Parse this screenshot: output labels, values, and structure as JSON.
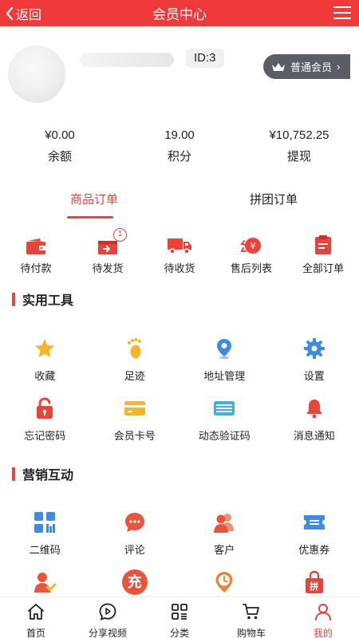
{
  "header": {
    "back_label": "返回",
    "title": "会员中心"
  },
  "profile": {
    "id_label": "ID:3",
    "level_label": "普通会员"
  },
  "stats": [
    {
      "value": "¥0.00",
      "label": "余额"
    },
    {
      "value": "19.00",
      "label": "积分"
    },
    {
      "value": "¥10,752.25",
      "label": "提现"
    }
  ],
  "tabs": [
    {
      "label": "商品订单"
    },
    {
      "label": "拼团订单"
    }
  ],
  "orders": [
    {
      "label": "待付款",
      "icon": "wallet-icon"
    },
    {
      "label": "待发货",
      "icon": "box-upload-icon",
      "badge": "1"
    },
    {
      "label": "待收货",
      "icon": "truck-icon"
    },
    {
      "label": "售后列表",
      "icon": "refund-icon"
    },
    {
      "label": "全部订单",
      "icon": "clipboard-icon"
    }
  ],
  "tools": {
    "title": "实用工具",
    "items": [
      {
        "label": "收藏",
        "icon": "star-icon"
      },
      {
        "label": "足迹",
        "icon": "footprint-icon"
      },
      {
        "label": "地址管理",
        "icon": "location-pin-icon"
      },
      {
        "label": "设置",
        "icon": "gear-icon"
      },
      {
        "label": "忘记密码",
        "icon": "lock-icon"
      },
      {
        "label": "会员卡号",
        "icon": "card-icon"
      },
      {
        "label": "动态验证码",
        "icon": "code-card-icon"
      },
      {
        "label": "消息通知",
        "icon": "bell-icon"
      }
    ]
  },
  "marketing": {
    "title": "营销互动",
    "items": [
      {
        "label": "二维码",
        "icon": "qr-grid-icon"
      },
      {
        "label": "评论",
        "icon": "comment-icon"
      },
      {
        "label": "客户",
        "icon": "customers-icon"
      },
      {
        "label": "优惠券",
        "icon": "coupon-icon"
      },
      {
        "label": "",
        "icon": "user-check-icon"
      },
      {
        "label": "充",
        "icon": "recharge-icon"
      },
      {
        "label": "",
        "icon": "clock-pin-icon"
      },
      {
        "label": "拼",
        "icon": "group-bag-icon"
      }
    ]
  },
  "tabbar": [
    {
      "label": "首页",
      "icon": "home-icon"
    },
    {
      "label": "分享视频",
      "icon": "video-share-icon"
    },
    {
      "label": "分类",
      "icon": "category-icon"
    },
    {
      "label": "购物车",
      "icon": "cart-icon"
    },
    {
      "label": "我的",
      "icon": "user-icon",
      "active": true
    }
  ],
  "colors": {
    "brand": "#f0393a",
    "accent": "#e8443c",
    "tool_yellow": "#f5b62b",
    "tool_blue": "#3f8be0"
  }
}
